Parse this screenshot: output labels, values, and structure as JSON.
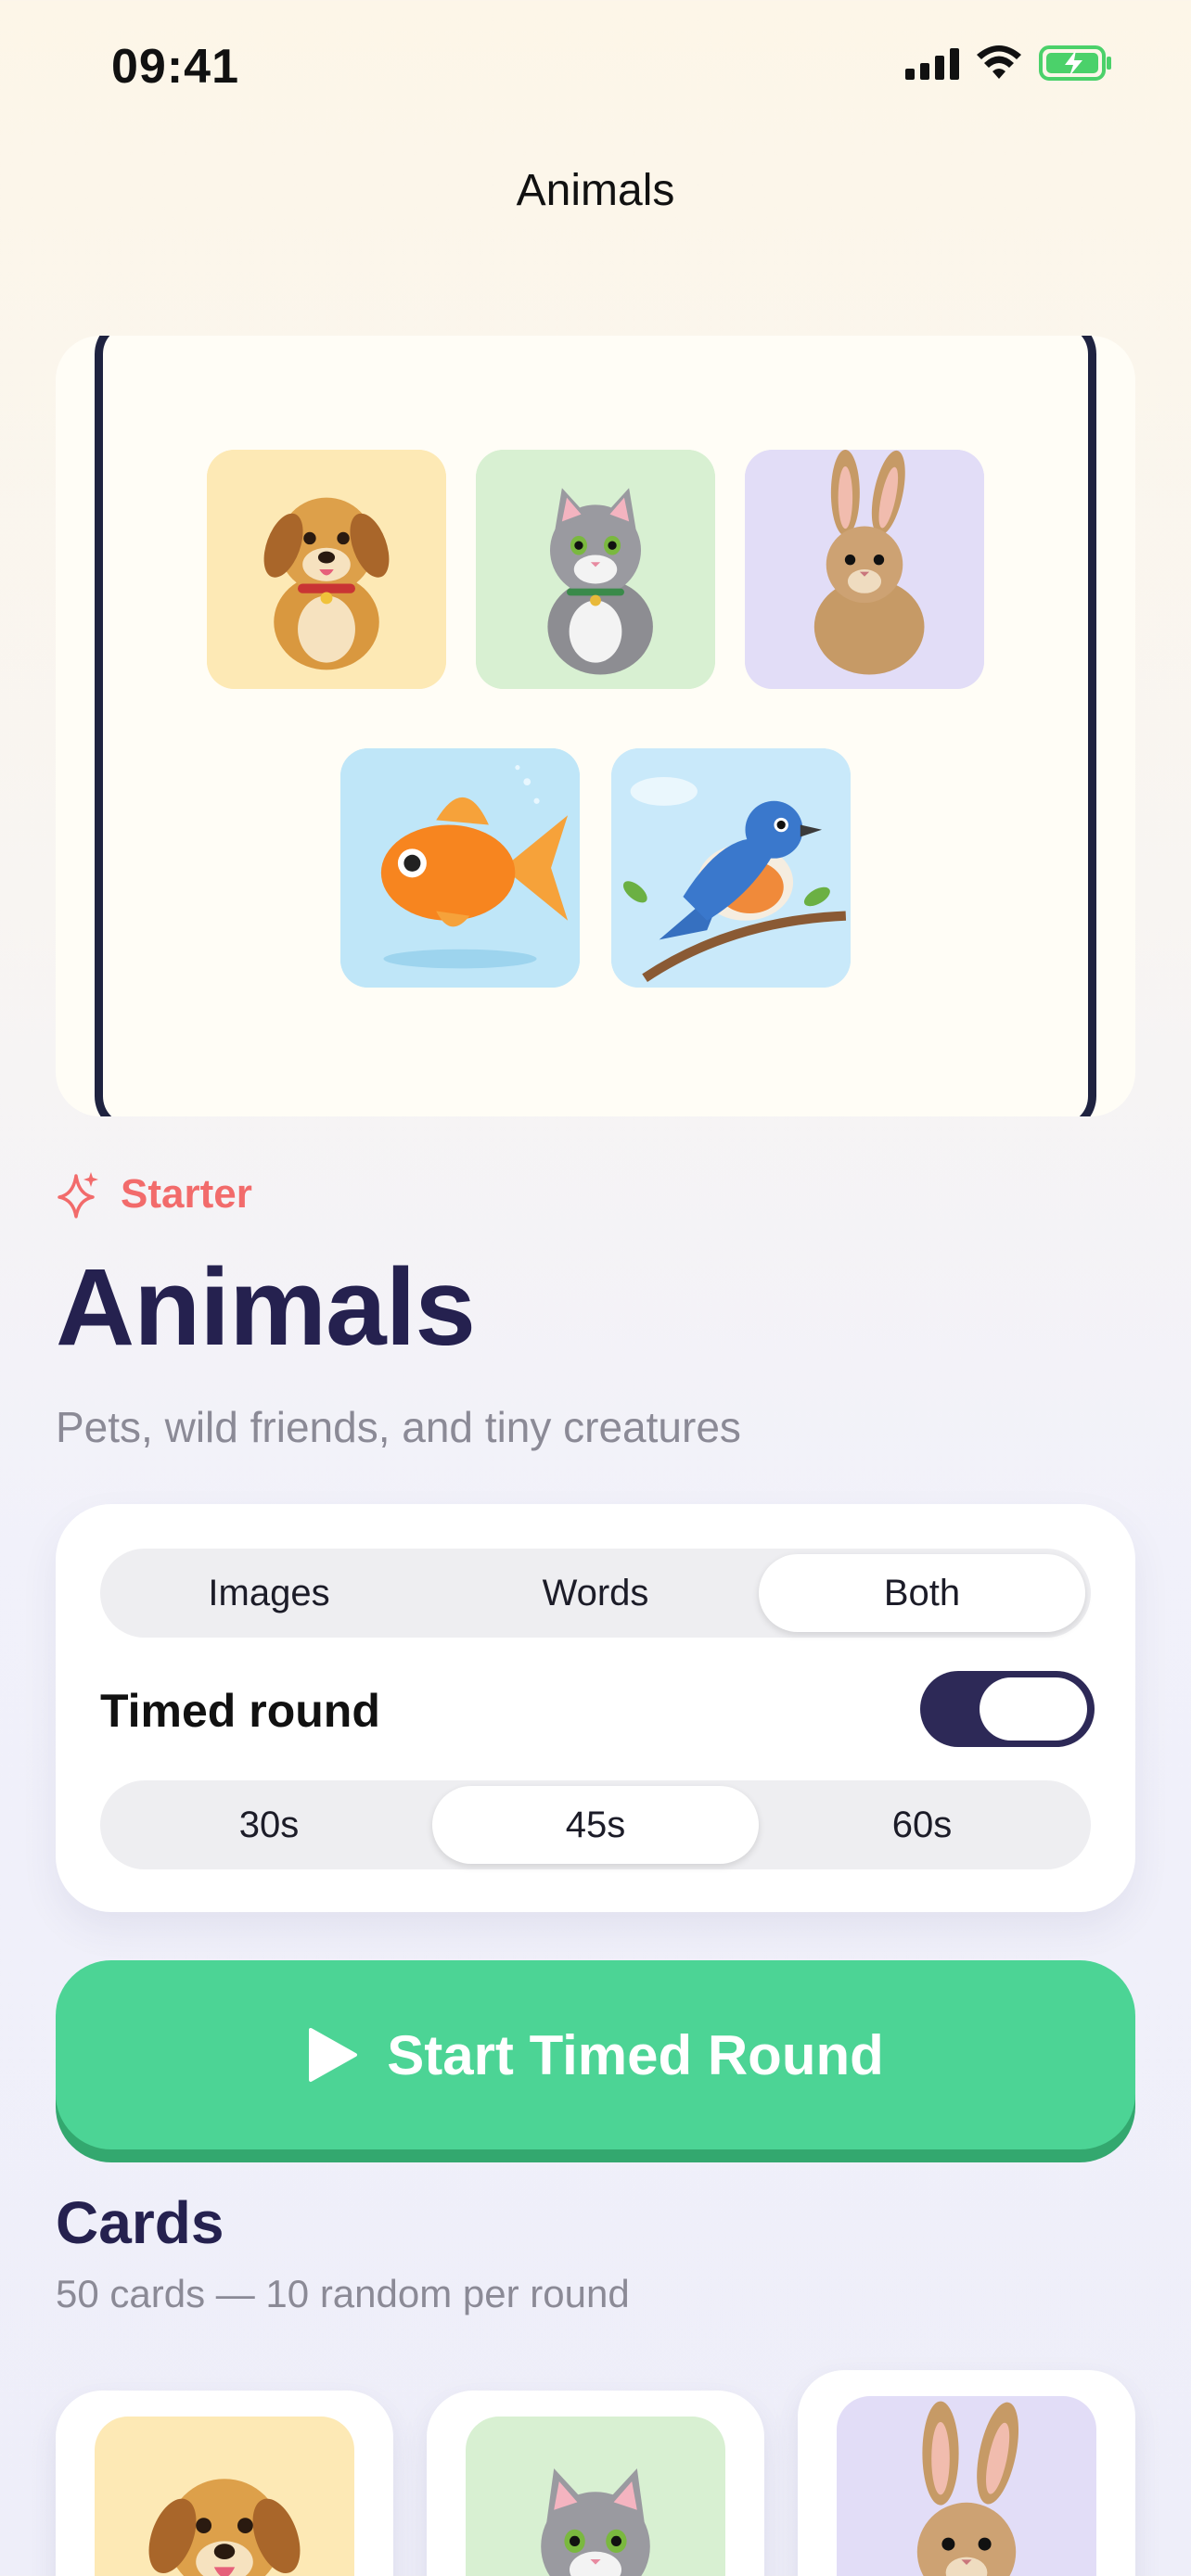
{
  "status_bar": {
    "time": "09:41"
  },
  "nav": {
    "title": "Animals"
  },
  "hero": {
    "tiles": [
      {
        "icon": "dog-icon",
        "bg": "#fde9b5"
      },
      {
        "icon": "cat-icon",
        "bg": "#d8f0d2"
      },
      {
        "icon": "rabbit-icon",
        "bg": "#e2ddf7"
      },
      {
        "icon": "goldfish-icon",
        "bg": "#bfe6f8"
      },
      {
        "icon": "bird-icon",
        "bg": "#c9e9fa"
      }
    ]
  },
  "category": {
    "label": "Starter",
    "icon": "sparkle-icon",
    "color": "#f26b6b"
  },
  "deck": {
    "title": "Animals",
    "subtitle": "Pets, wild friends, and tiny creatures"
  },
  "settings": {
    "modes": [
      "Images",
      "Words",
      "Both"
    ],
    "selected_mode": "Both",
    "timed_round_label": "Timed round",
    "timed_round_on": true,
    "durations": [
      "30s",
      "45s",
      "60s"
    ],
    "selected_duration": "45s"
  },
  "start_button": {
    "label": "Start Timed Round",
    "icon": "play-icon",
    "color": "#4cd495"
  },
  "cards_section": {
    "title": "Cards",
    "subtitle": "50 cards — 10 random per round",
    "preview": [
      "dog-icon",
      "cat-icon",
      "rabbit-icon"
    ]
  },
  "colors": {
    "accent_dark": "#2d2957",
    "heading": "#25214f"
  }
}
